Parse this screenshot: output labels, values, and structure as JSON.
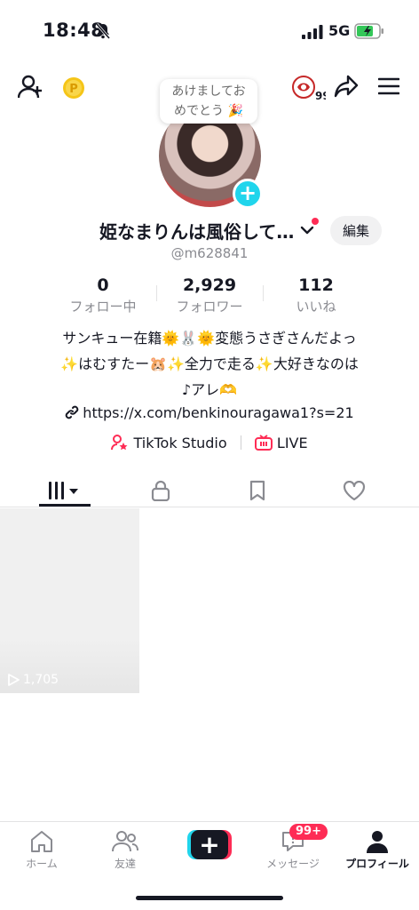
{
  "status": {
    "time": "18:48",
    "network": "5G"
  },
  "header": {
    "coin_icon": "coin-icon",
    "notifications_badge": "99"
  },
  "note": {
    "line1": "あけましてお",
    "line2": "めでとう 🎉"
  },
  "profile": {
    "name": "姫なまりんは風俗して…",
    "handle": "@m628841",
    "edit_label": "編集"
  },
  "stats": [
    {
      "value": "0",
      "label": "フォロー中"
    },
    {
      "value": "2,929",
      "label": "フォロワー"
    },
    {
      "value": "112",
      "label": "いいね"
    }
  ],
  "bio": {
    "line1": "サンキュー在籍🌞🐰🌞変態うさぎさんだよっ",
    "line2": "✨はむすたー🐹✨全力で走る✨大好きなのは",
    "line3": "♪アレ🫶",
    "link": "https://x.com/benkinouragawa1?s=21"
  },
  "actions": {
    "studio_label": "TikTok Studio",
    "live_label": "LIVE"
  },
  "tabs": [
    "videos-tab",
    "private-tab",
    "saved-tab",
    "liked-tab"
  ],
  "videos": [
    {
      "views": "1,705"
    }
  ],
  "nav": {
    "home": "ホーム",
    "friends": "友達",
    "messages": "メッセージ",
    "messages_badge": "99+",
    "profile": "プロフィール"
  },
  "colors": {
    "accent": "#fe2c55",
    "cyan": "#20d5ec",
    "text": "#161823",
    "muted": "#8a8b91"
  }
}
